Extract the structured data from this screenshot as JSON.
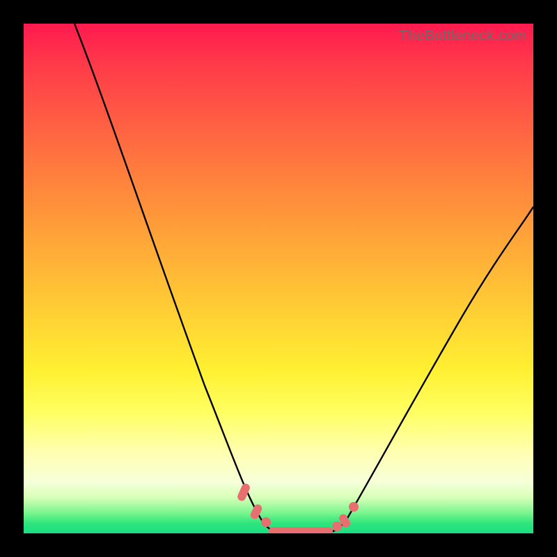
{
  "watermark": "TheBottleneck.com",
  "colors": {
    "frame": "#000000",
    "curve_stroke": "#000000",
    "marker_fill": "#e76f6f",
    "gradient_top": "#ff1a4e",
    "gradient_bottom": "#19df82"
  },
  "chart_data": {
    "type": "line",
    "title": "",
    "xlabel": "",
    "ylabel": "",
    "xlim": [
      0,
      100
    ],
    "ylim": [
      0,
      100
    ],
    "annotations": [
      "TheBottleneck.com"
    ],
    "series": [
      {
        "name": "left-curve",
        "x": [
          10,
          15,
          20,
          25,
          30,
          35,
          40,
          43,
          45,
          47,
          49
        ],
        "y": [
          100,
          86,
          72,
          58,
          44,
          30,
          16,
          8,
          4,
          1.5,
          0.5
        ]
      },
      {
        "name": "right-curve",
        "x": [
          60,
          62,
          65,
          70,
          75,
          80,
          85,
          90,
          95,
          100
        ],
        "y": [
          0.5,
          2,
          6,
          14,
          23,
          32,
          41,
          49,
          57,
          64
        ]
      },
      {
        "name": "bottom-markers",
        "x": [
          43,
          45,
          47,
          49,
          51,
          53,
          55,
          57,
          60,
          62
        ],
        "y": [
          8,
          4,
          1.5,
          0.5,
          0.4,
          0.4,
          0.4,
          0.5,
          0.5,
          2
        ]
      }
    ]
  }
}
